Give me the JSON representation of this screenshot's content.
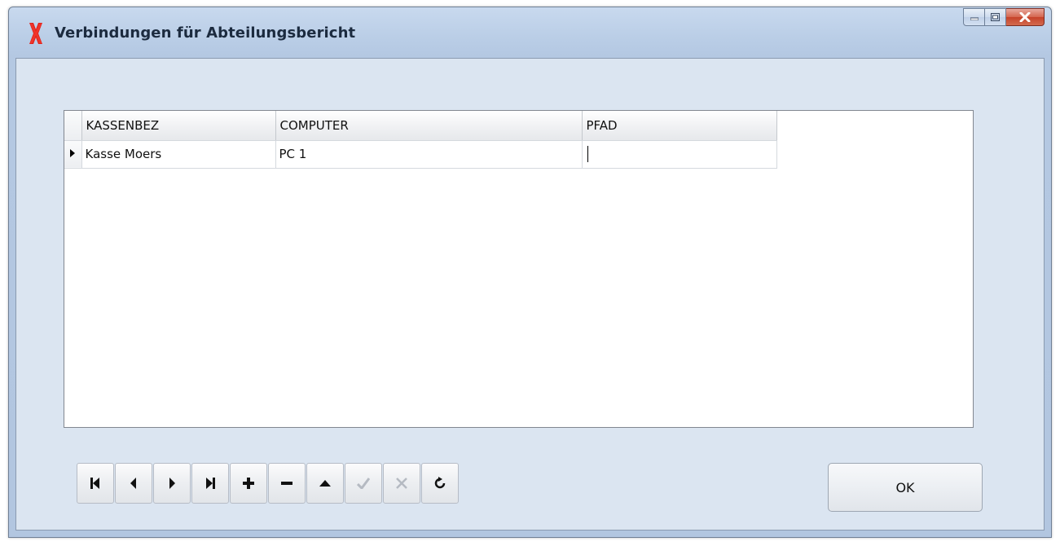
{
  "window": {
    "title": "Verbindungen für Abteilungsbericht",
    "caption_buttons": {
      "minimize_icon": "minimize-icon",
      "maximize_icon": "maximize-icon",
      "close_icon": "close-icon"
    }
  },
  "grid": {
    "columns": [
      "KASSENBEZ",
      "COMPUTER",
      "PFAD"
    ],
    "rows": [
      {
        "kassenbez": "Kasse Moers",
        "computer": "PC 1",
        "pfad": ""
      }
    ]
  },
  "navigator": {
    "buttons": [
      {
        "icon": "first-record-icon",
        "glyph": "⏮",
        "enabled": true
      },
      {
        "icon": "prior-record-icon",
        "glyph": "◂",
        "enabled": true
      },
      {
        "icon": "next-record-icon",
        "glyph": "▸",
        "enabled": true
      },
      {
        "icon": "last-record-icon",
        "glyph": "⏭",
        "enabled": true
      },
      {
        "icon": "insert-record-icon",
        "glyph": "+",
        "enabled": true
      },
      {
        "icon": "delete-record-icon",
        "glyph": "−",
        "enabled": true
      },
      {
        "icon": "edit-record-icon",
        "glyph": "▴",
        "enabled": true
      },
      {
        "icon": "post-record-icon",
        "glyph": "✔",
        "enabled": false
      },
      {
        "icon": "cancel-edit-icon",
        "glyph": "✕",
        "enabled": false
      },
      {
        "icon": "refresh-icon",
        "glyph": "↻",
        "enabled": true
      }
    ]
  },
  "ok_button": {
    "label": "OK"
  },
  "colors": {
    "accent_red": "#e0231c",
    "window_frame": "#b9cde6",
    "client_bg": "#dbe5f1"
  }
}
